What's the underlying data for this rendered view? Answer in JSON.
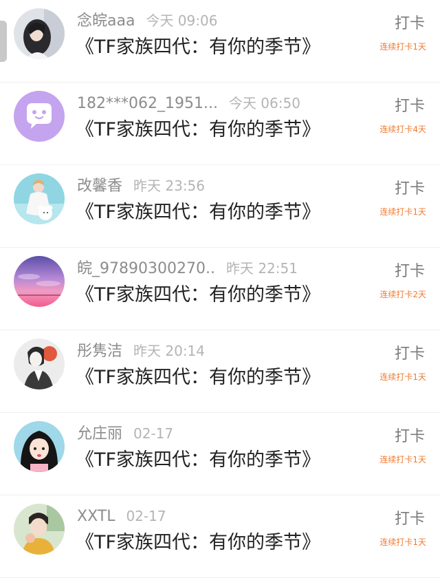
{
  "colors": {
    "username": "#8c8c8c",
    "time": "#b4b4b4",
    "title": "#222222",
    "checkin": "#7a7a7a",
    "streak": "#f07a2e"
  },
  "entries": [
    {
      "username": "念皖aaa",
      "time": "今天 09:06",
      "title": "《TF家族四代：有你的季节》",
      "checkin_label": "打卡",
      "streak": "连续打卡1天",
      "avatar": "avatar-girl-dark-hair-icon"
    },
    {
      "username": "182***062_1951...",
      "time": "今天 06:50",
      "title": "《TF家族四代：有你的季节》",
      "checkin_label": "打卡",
      "streak": "连续打卡4天",
      "avatar": "avatar-chat-bubble-icon"
    },
    {
      "username": "改馨香",
      "time": "昨天 23:56",
      "title": "《TF家族四代：有你的季节》",
      "checkin_label": "打卡",
      "streak": "连续打卡1天",
      "avatar": "avatar-woman-with-bear-icon"
    },
    {
      "username": "皖_97890300270..",
      "time": "昨天 22:51",
      "title": "《TF家族四代：有你的季节》",
      "checkin_label": "打卡",
      "streak": "连续打卡2天",
      "avatar": "avatar-sunset-sky-icon"
    },
    {
      "username": "彤隽洁",
      "time": "昨天 20:14",
      "title": "《TF家族四代：有你的季节》",
      "checkin_label": "打卡",
      "streak": "连续打卡1天",
      "avatar": "avatar-sketch-portrait-icon"
    },
    {
      "username": "允庄丽",
      "time": "02-17",
      "title": "《TF家族四代：有你的季节》",
      "checkin_label": "打卡",
      "streak": "连续打卡1天",
      "avatar": "avatar-cartoon-girl-icon"
    },
    {
      "username": "XXTL",
      "time": "02-17",
      "title": "《TF家族四代：有你的季节》",
      "checkin_label": "打卡",
      "streak": "连续打卡1天",
      "avatar": "avatar-boy-illustration-icon"
    }
  ]
}
